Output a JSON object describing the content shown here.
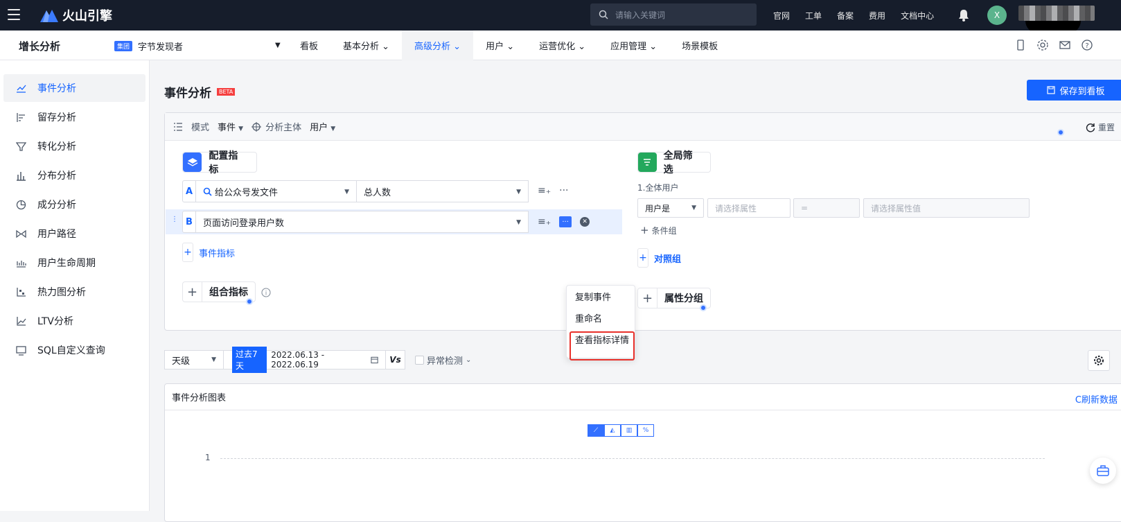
{
  "topbar": {
    "brand": "火山引擎",
    "search_placeholder": "请输入关键词",
    "links": [
      "官网",
      "工单",
      "备案",
      "费用",
      "文档中心"
    ],
    "avatar_letter": "X"
  },
  "navbar": {
    "title": "增长分析",
    "group_badge": "集团",
    "project": "字节发现者",
    "items": [
      {
        "label": "看板"
      },
      {
        "label": "基本分析 ⌄"
      },
      {
        "label": "高级分析 ⌄"
      },
      {
        "label": "用户 ⌄"
      },
      {
        "label": "运营优化 ⌄"
      },
      {
        "label": "应用管理 ⌄"
      },
      {
        "label": "场景模板"
      }
    ]
  },
  "sidebar": {
    "items": [
      {
        "label": "事件分析",
        "icon": "line-chart-icon"
      },
      {
        "label": "留存分析",
        "icon": "retention-icon"
      },
      {
        "label": "转化分析",
        "icon": "funnel-icon"
      },
      {
        "label": "分布分析",
        "icon": "bar-chart-icon"
      },
      {
        "label": "成分分析",
        "icon": "pie-chart-icon"
      },
      {
        "label": "用户路径",
        "icon": "path-icon"
      },
      {
        "label": "用户生命周期",
        "icon": "lifecycle-icon"
      },
      {
        "label": "热力图分析",
        "icon": "heatmap-icon"
      },
      {
        "label": "LTV分析",
        "icon": "ltv-icon"
      },
      {
        "label": "SQL自定义查询",
        "icon": "sql-icon"
      }
    ]
  },
  "page": {
    "title": "事件分析",
    "beta": "BETA",
    "save_button": "保存到看板"
  },
  "config": {
    "mode_label": "模式",
    "mode_value": "事件",
    "subject_label": "分析主体",
    "subject_value": "用户",
    "reset": "重置",
    "metrics_title": "配置指标",
    "row_a": {
      "letter": "A",
      "event": "给公众号发文件",
      "measure": "总人数"
    },
    "row_b": {
      "letter": "B",
      "event": "页面访问登录用户数"
    },
    "add_event_metric": "事件指标",
    "combo_metric": "组合指标",
    "menu": [
      "复制事件",
      "重命名",
      "查看指标详情"
    ],
    "filter_title": "全局筛选",
    "filter_group": "1.全体用户",
    "filter_user": "用户是",
    "filter_attr_placeholder": "请选择属性",
    "filter_op": "=",
    "filter_value_placeholder": "请选择属性值",
    "add_condition": "条件组",
    "compare_group": "对照组",
    "attr_group": "属性分组"
  },
  "toolbar": {
    "granularity": "天级",
    "range_tag": "过去7天",
    "range": "2022.06.13 - 2022.06.19",
    "vs": "Vs",
    "anomaly": "异常检测"
  },
  "chart": {
    "title": "事件分析图表",
    "refresh": "C刷新数据",
    "ytick": "1"
  },
  "colors": {
    "accent": "#1664ff",
    "topbar": "#161d2b",
    "highlight": "#e8302a"
  }
}
